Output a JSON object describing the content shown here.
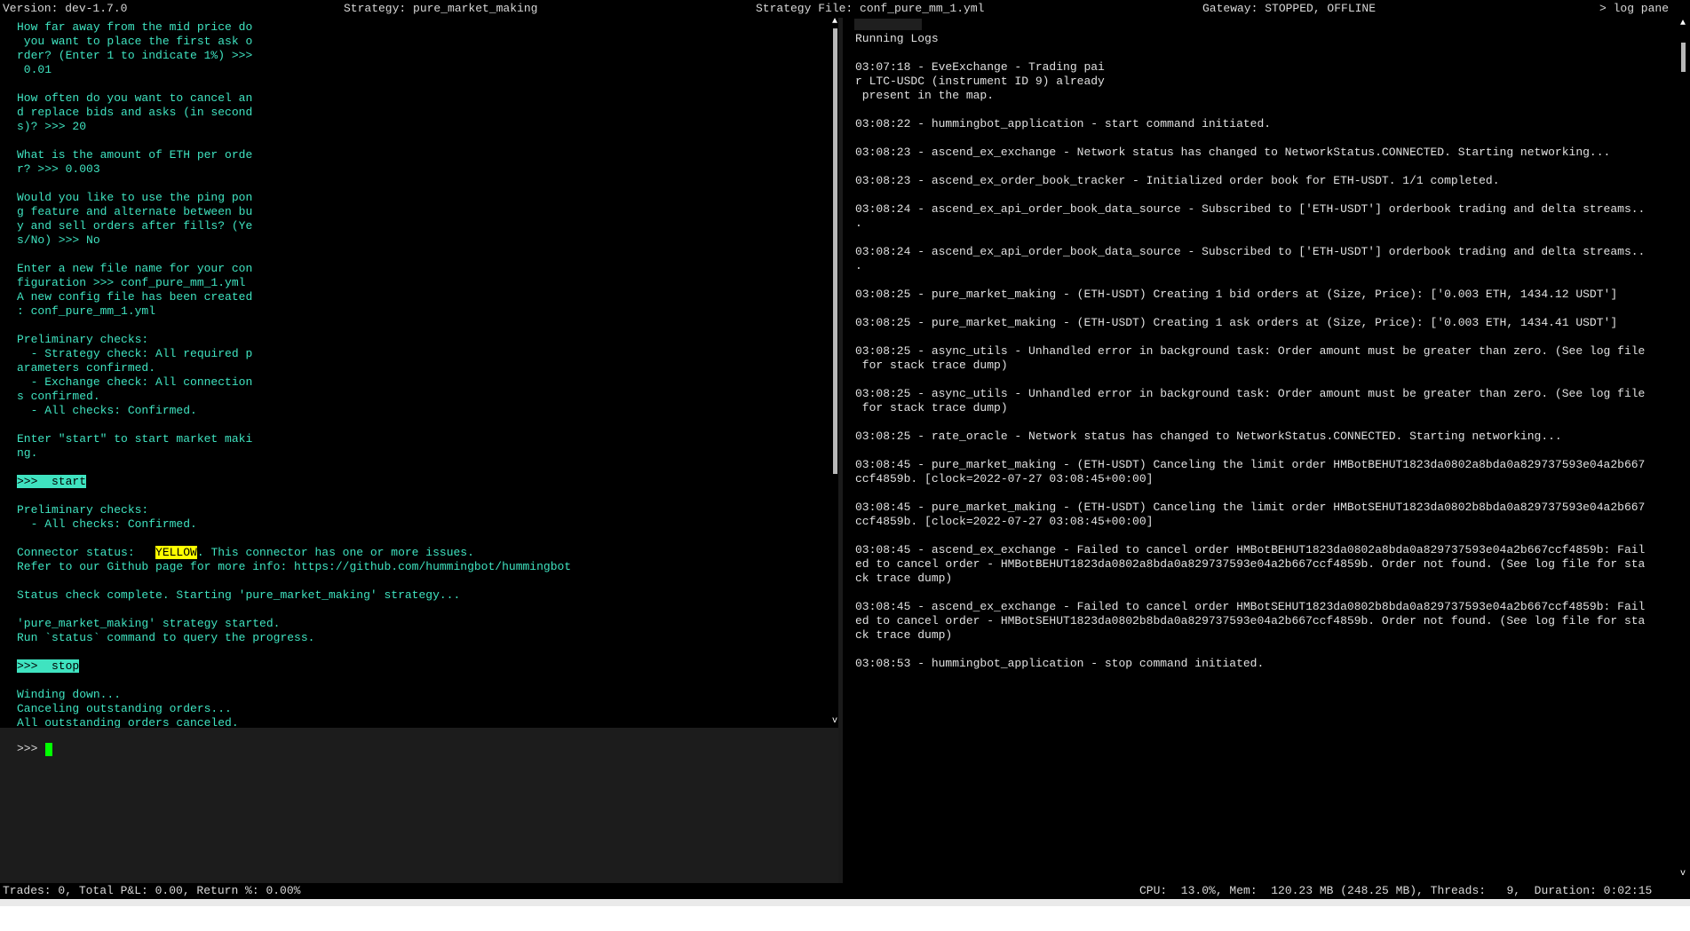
{
  "header": {
    "version": "Version: dev-1.7.0",
    "strategy": "Strategy: pure_market_making",
    "strategy_file": "Strategy File: conf_pure_mm_1.yml",
    "gateway": "Gateway: STOPPED, OFFLINE",
    "log_pane_toggle": "> log pane"
  },
  "output": {
    "block1": "How far away from the mid price do\n you want to place the first ask o\nrder? (Enter 1 to indicate 1%) >>>\n 0.01\n\nHow often do you want to cancel an\nd replace bids and asks (in second\ns)? >>> 20\n\nWhat is the amount of ETH per orde\nr? >>> 0.003\n\nWould you like to use the ping pon\ng feature and alternate between bu\ny and sell orders after fills? (Ye\ns/No) >>> No\n\nEnter a new file name for your con\nfiguration >>> conf_pure_mm_1.yml\nA new config file has been created\n: conf_pure_mm_1.yml\n\nPreliminary checks:\n  - Strategy check: All required p\narameters confirmed.\n  - Exchange check: All connection\ns confirmed.\n  - All checks: Confirmed.\n\nEnter \"start\" to start market maki\nng.\n",
    "cmd_start": ">>>  start",
    "block2": "Preliminary checks:\n  - All checks: Confirmed.\n",
    "connector_prefix": "Connector status:   ",
    "connector_status": "YELLOW",
    "connector_suffix": ". This connector has one or more issues.",
    "block3": "Refer to our Github page for more info: https://github.com/hummingbot/hummingbot\n\nStatus check complete. Starting 'pure_market_making' strategy...\n\n'pure_market_making' strategy started.\nRun `status` command to query the progress.\n",
    "cmd_stop": ">>>  stop",
    "block4": "Winding down...\nCanceling outstanding orders...\nAll outstanding orders canceled."
  },
  "input": {
    "prompt": ">>> "
  },
  "logs": {
    "title": "Running Logs",
    "text": "03:07:18 - EveExchange - Trading pai\nr LTC-USDC (instrument ID 9) already\n present in the map.\n\n03:08:22 - hummingbot_application - start command initiated.\n\n03:08:23 - ascend_ex_exchange - Network status has changed to NetworkStatus.CONNECTED. Starting networking...\n\n03:08:23 - ascend_ex_order_book_tracker - Initialized order book for ETH-USDT. 1/1 completed.\n\n03:08:24 - ascend_ex_api_order_book_data_source - Subscribed to ['ETH-USDT'] orderbook trading and delta streams..\n.\n\n03:08:24 - ascend_ex_api_order_book_data_source - Subscribed to ['ETH-USDT'] orderbook trading and delta streams..\n.\n\n03:08:25 - pure_market_making - (ETH-USDT) Creating 1 bid orders at (Size, Price): ['0.003 ETH, 1434.12 USDT']\n\n03:08:25 - pure_market_making - (ETH-USDT) Creating 1 ask orders at (Size, Price): ['0.003 ETH, 1434.41 USDT']\n\n03:08:25 - async_utils - Unhandled error in background task: Order amount must be greater than zero. (See log file\n for stack trace dump)\n\n03:08:25 - async_utils - Unhandled error in background task: Order amount must be greater than zero. (See log file\n for stack trace dump)\n\n03:08:25 - rate_oracle - Network status has changed to NetworkStatus.CONNECTED. Starting networking...\n\n03:08:45 - pure_market_making - (ETH-USDT) Canceling the limit order HMBotBEHUT1823da0802a8bda0a829737593e04a2b667\nccf4859b. [clock=2022-07-27 03:08:45+00:00]\n\n03:08:45 - pure_market_making - (ETH-USDT) Canceling the limit order HMBotSEHUT1823da0802b8bda0a829737593e04a2b667\nccf4859b. [clock=2022-07-27 03:08:45+00:00]\n\n03:08:45 - ascend_ex_exchange - Failed to cancel order HMBotBEHUT1823da0802a8bda0a829737593e04a2b667ccf4859b: Fail\ned to cancel order - HMBotBEHUT1823da0802a8bda0a829737593e04a2b667ccf4859b. Order not found. (See log file for sta\nck trace dump)\n\n03:08:45 - ascend_ex_exchange - Failed to cancel order HMBotSEHUT1823da0802b8bda0a829737593e04a2b667ccf4859b: Fail\ned to cancel order - HMBotSEHUT1823da0802b8bda0a829737593e04a2b667ccf4859b. Order not found. (See log file for sta\nck trace dump)\n\n03:08:53 - hummingbot_application - stop command initiated."
  },
  "status": {
    "trades": "Trades: 0, Total P&L: 0.00, Return %: 0.00%",
    "system": "CPU:  13.0%, Mem:  120.23 MB (248.25 MB), Threads:   9,  Duration: 0:02:15"
  },
  "colors": {
    "terminal_bg": "#000000",
    "output_text": "#3fe3c0",
    "log_text": "#e0e0e0",
    "cursor": "#00ff00",
    "warning": "#ffff00"
  }
}
